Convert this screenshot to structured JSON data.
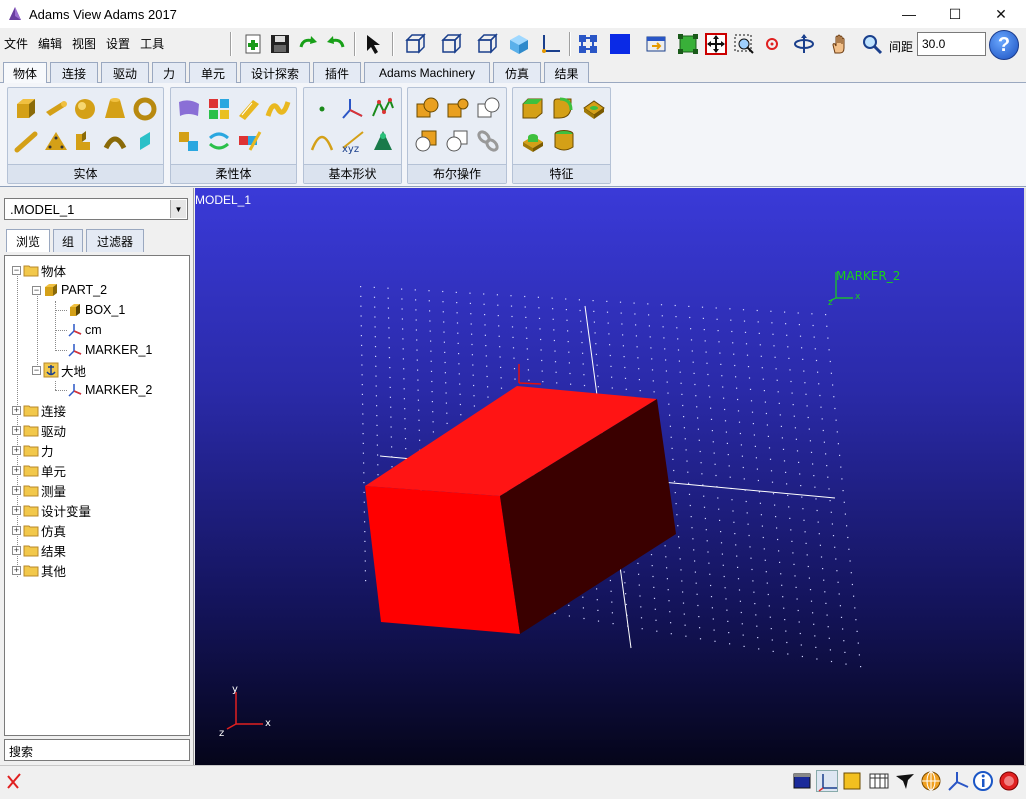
{
  "window": {
    "title": "Adams View Adams 2017",
    "minimize": "—",
    "maximize": "☐",
    "close": "✕"
  },
  "menu": [
    "文件",
    "编辑",
    "视图",
    "设置",
    "工具"
  ],
  "toolbar": {
    "gap_label": "间距",
    "gap_value": "30.0",
    "help": "?"
  },
  "ribbon_tabs": [
    "物体",
    "连接",
    "驱动",
    "力",
    "单元",
    "设计探索",
    "插件",
    "Adams Machinery",
    "仿真",
    "结果"
  ],
  "ribbon_groups": [
    "实体",
    "柔性体",
    "基本形状",
    "布尔操作",
    "特征"
  ],
  "left": {
    "model": ".MODEL_1",
    "tabs": [
      "浏览",
      "组",
      "过滤器"
    ],
    "tree": {
      "bodies": "物体",
      "part2": "PART_2",
      "box1": "BOX_1",
      "cm": "cm",
      "marker1": "MARKER_1",
      "ground": "大地",
      "marker2": "MARKER_2",
      "others": [
        "连接",
        "驱动",
        "力",
        "单元",
        "测量",
        "设计变量",
        "仿真",
        "结果",
        "其他"
      ]
    },
    "search_placeholder": "搜索"
  },
  "viewport": {
    "model_label": "MODEL_1",
    "marker_label": "MARKER_2",
    "axis_x": "x",
    "axis_y": "y",
    "axis_z": "z"
  },
  "colors": {
    "box_front": "#ff0000",
    "box_top": "#ff1a1a",
    "box_side": "#3a0000",
    "marker_green": "#19d219"
  }
}
